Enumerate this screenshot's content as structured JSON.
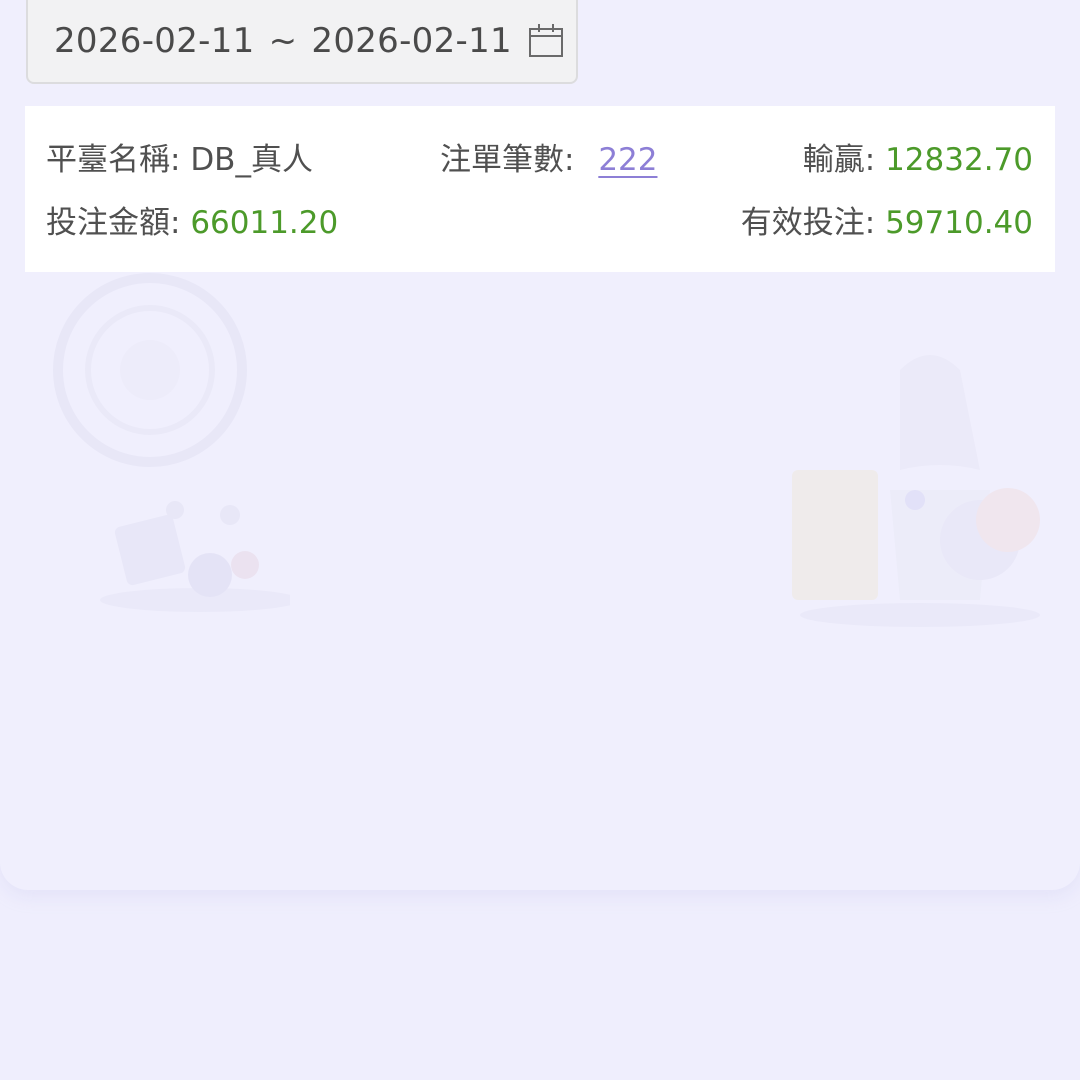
{
  "date_range": {
    "start": "2026-02-11",
    "separator": "~",
    "end": "2026-02-11",
    "icon": "calendar-icon"
  },
  "summary": {
    "platform_label": "平臺名稱:",
    "platform_value": "DB_真人",
    "bet_count_label": "注單筆數:",
    "bet_count_value": "222",
    "win_loss_label": "輸贏:",
    "win_loss_value": "12832.70",
    "bet_amount_label": "投注金額:",
    "bet_amount_value": "66011.20",
    "valid_bet_label": "有效投注:",
    "valid_bet_value": "59710.40"
  },
  "colors": {
    "page_background": "#efeefd",
    "value_green": "#4c9a2a",
    "link_purple": "#8d7fd6"
  }
}
